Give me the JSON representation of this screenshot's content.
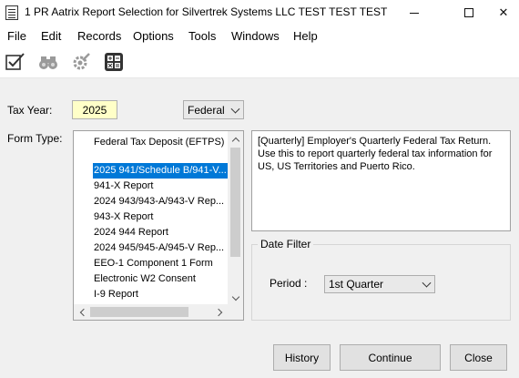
{
  "window": {
    "title": "1 PR Aatrix Report Selection for Silvertrek Systems LLC TEST TEST TEST"
  },
  "menu": [
    "File",
    "Edit",
    "Records",
    "Options",
    "Tools",
    "Windows",
    "Help"
  ],
  "toolbar_icons": [
    "edit-checkbox-icon",
    "binoculars-icon",
    "settings-gear-icon",
    "calculator-icon"
  ],
  "tax_year": {
    "label": "Tax Year:",
    "value": "2025",
    "jurisdiction": "Federal"
  },
  "form_type": {
    "label": "Form Type:",
    "selected_index": 1,
    "items": [
      "Federal Tax Deposit (EFTPS)",
      "2025 941/Schedule B/941-V...",
      "941-X Report",
      "2024 943/943-A/943-V Rep...",
      "943-X Report",
      "2024 944 Report",
      "2024 945/945-A/945-V Rep...",
      "EEO-1 Component 1 Form",
      "Electronic W2 Consent",
      "I-9 Report"
    ]
  },
  "description": "[Quarterly] Employer's Quarterly Federal Tax Return. Use this to report quarterly federal tax information for US, US Territories and Puerto Rico.",
  "date_filter": {
    "title": "Date Filter",
    "period_label": "Period :",
    "period_value": "1st Quarter"
  },
  "buttons": {
    "history": "History",
    "continue": "Continue",
    "close": "Close"
  },
  "colors": {
    "selection": "#0078d7",
    "year_field": "#ffffc8"
  }
}
